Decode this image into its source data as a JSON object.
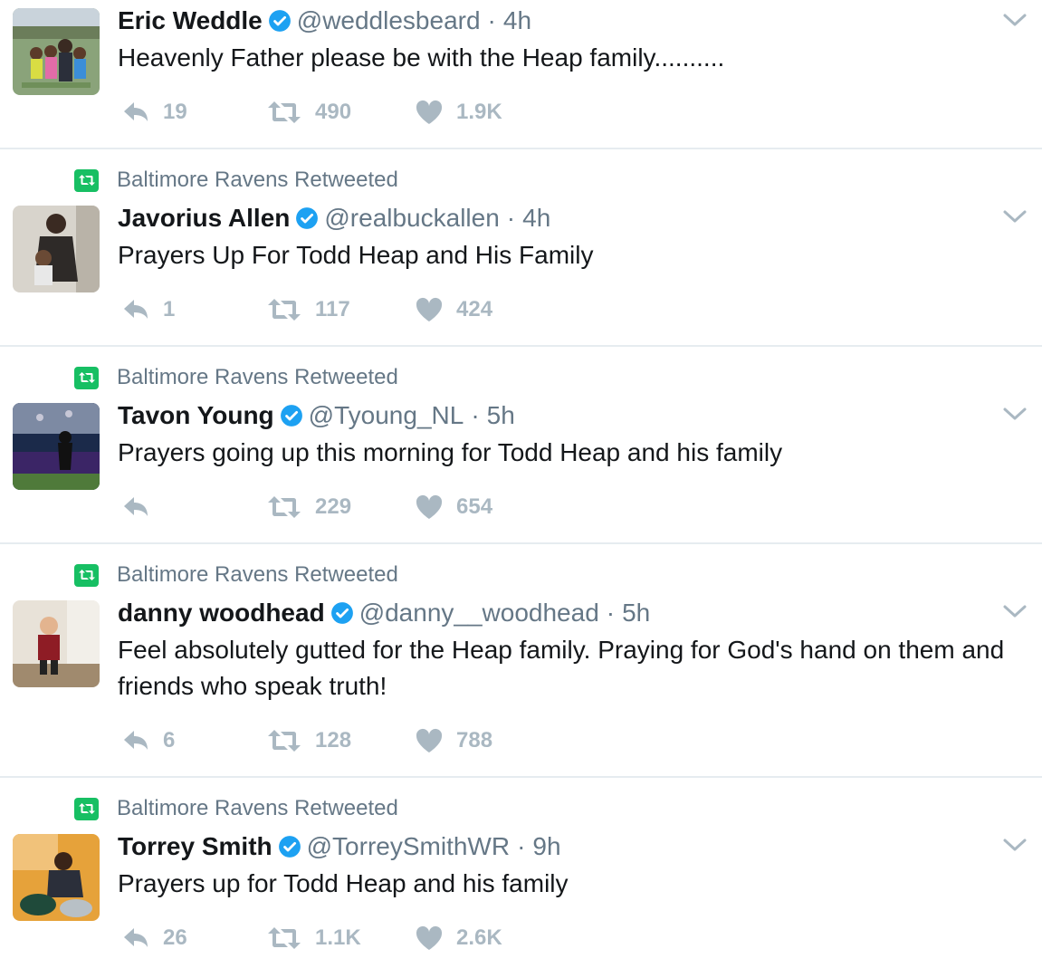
{
  "colors": {
    "icon": "#aab8c2",
    "muted": "#657786",
    "verified": "#1da1f2",
    "retweet_badge": "#17bf63"
  },
  "tweets": [
    {
      "retweeted_by": "",
      "name": "Eric Weddle",
      "handle": "@weddlesbeard",
      "time": "4h",
      "text": "Heavenly Father please be with the Heap family..........",
      "replies": "19",
      "retweets": "490",
      "likes": "1.9K"
    },
    {
      "retweeted_by": "Baltimore Ravens Retweeted",
      "name": "Javorius Allen",
      "handle": "@realbuckallen",
      "time": "4h",
      "text": "Prayers Up For Todd Heap and His Family",
      "replies": "1",
      "retweets": "117",
      "likes": "424"
    },
    {
      "retweeted_by": "Baltimore Ravens Retweeted",
      "name": "Tavon Young",
      "handle": "@Tyoung_NL",
      "time": "5h",
      "text": "Prayers going up this morning for Todd Heap and his family",
      "replies": "",
      "retweets": "229",
      "likes": "654"
    },
    {
      "retweeted_by": "Baltimore Ravens Retweeted",
      "name": "danny woodhead",
      "handle": "@danny__woodhead",
      "time": "5h",
      "text": "Feel absolutely gutted for the Heap family. Praying for God's hand on them and friends who speak truth!",
      "replies": "6",
      "retweets": "128",
      "likes": "788"
    },
    {
      "retweeted_by": "Baltimore Ravens Retweeted",
      "name": "Torrey Smith",
      "handle": "@TorreySmithWR",
      "time": "9h",
      "text": "Prayers up for Todd Heap and his family",
      "replies": "26",
      "retweets": "1.1K",
      "likes": "2.6K"
    }
  ]
}
